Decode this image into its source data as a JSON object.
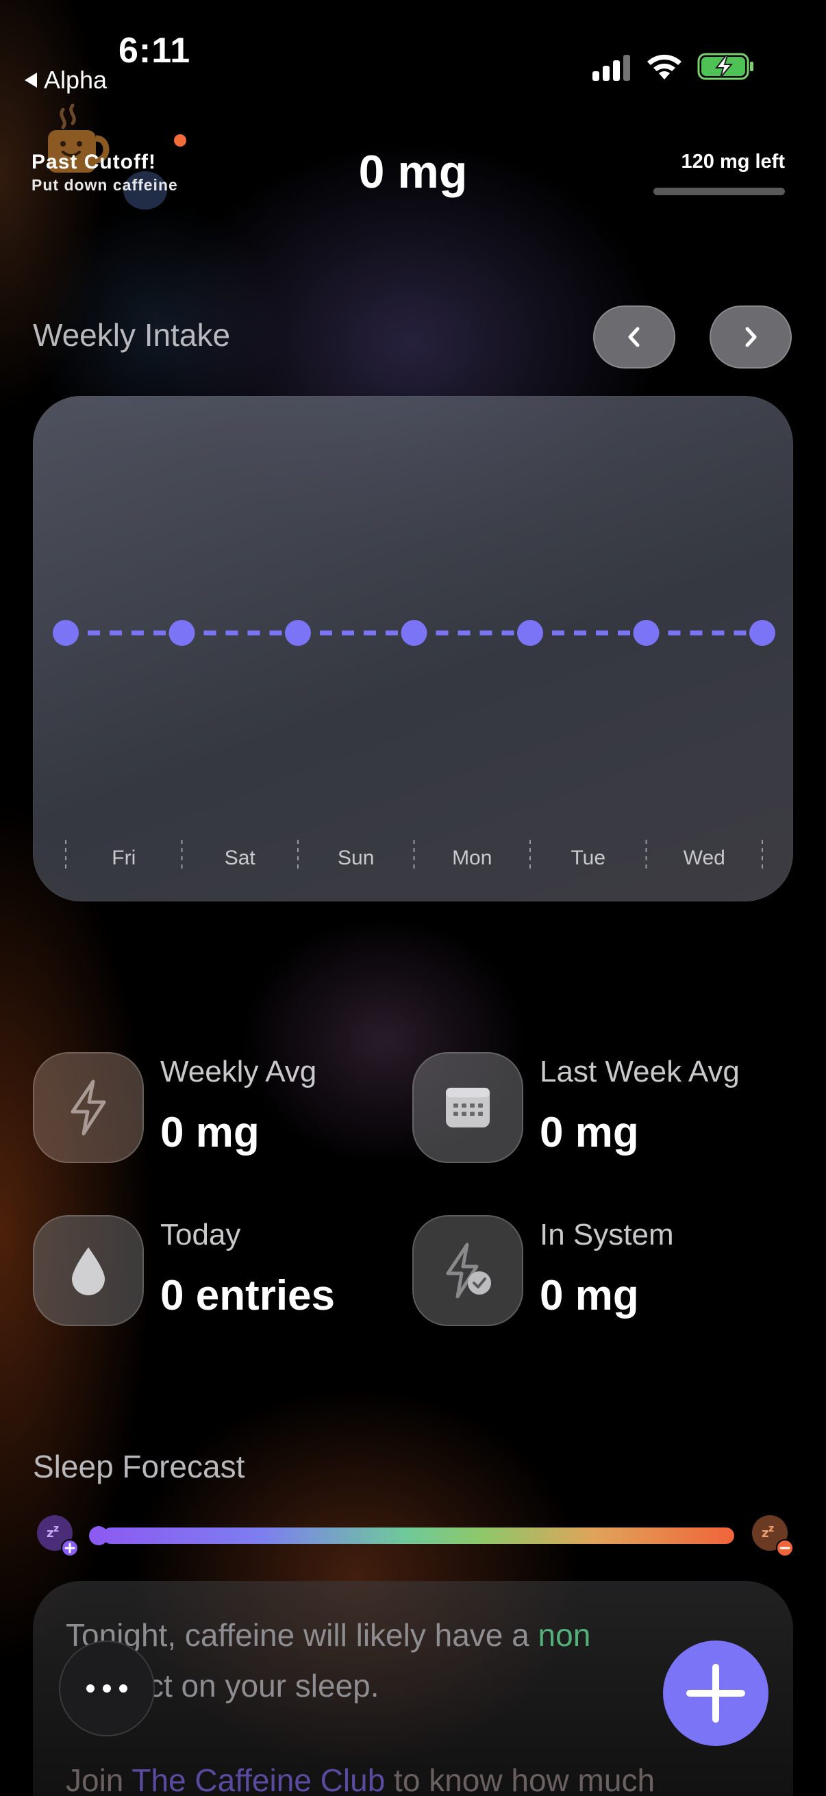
{
  "status_bar": {
    "time": "6:11",
    "back_label": "Alpha",
    "icons": [
      "cellular-signal-icon",
      "wifi-icon",
      "battery-charging-icon"
    ]
  },
  "header": {
    "cutoff_title": "Past Cutoff!",
    "cutoff_subtitle": "Put down caffeine",
    "total_today": "0 mg",
    "remaining_label": "120 mg left",
    "remaining_fraction": 0.0
  },
  "weekly": {
    "title": "Weekly Intake",
    "prev_icon": "chevron-left-icon",
    "next_icon": "chevron-right-icon"
  },
  "chart_data": {
    "type": "line",
    "categories": [
      "Fri",
      "Sat",
      "Sun",
      "Mon",
      "Tue",
      "Wed"
    ],
    "series": [
      {
        "values": [
          0,
          0,
          0,
          0,
          0,
          0,
          0
        ]
      }
    ],
    "line_style": "dashed",
    "color": "#7b74f6",
    "grid": false
  },
  "stats": [
    {
      "label": "Weekly Avg",
      "value": "0 mg",
      "icon": "bolt-icon"
    },
    {
      "label": "Last Week Avg",
      "value": "0 mg",
      "icon": "calendar-icon"
    },
    {
      "label": "Today",
      "value": "0 entries",
      "icon": "drop-icon"
    },
    {
      "label": "In System",
      "value": "0 mg",
      "icon": "bolt-check-icon"
    }
  ],
  "sleep": {
    "title": "Sleep Forecast",
    "forecast_prefix": "Tonight, caffeine will likely have a ",
    "forecast_highlight": "non",
    "forecast_line2": "ct on your sleep.",
    "club_prefix": "Join ",
    "club_link": "The Caffeine Club",
    "club_suffix": " to know how much",
    "gradient_colors": [
      "#8c5cf2",
      "#7d7ef0",
      "#6fc99a",
      "#8ec86a",
      "#e0a35a",
      "#f0643a"
    ]
  },
  "colors": {
    "accent": "#7b74f6",
    "warning": "#f26b3a",
    "good": "#54b07a"
  }
}
